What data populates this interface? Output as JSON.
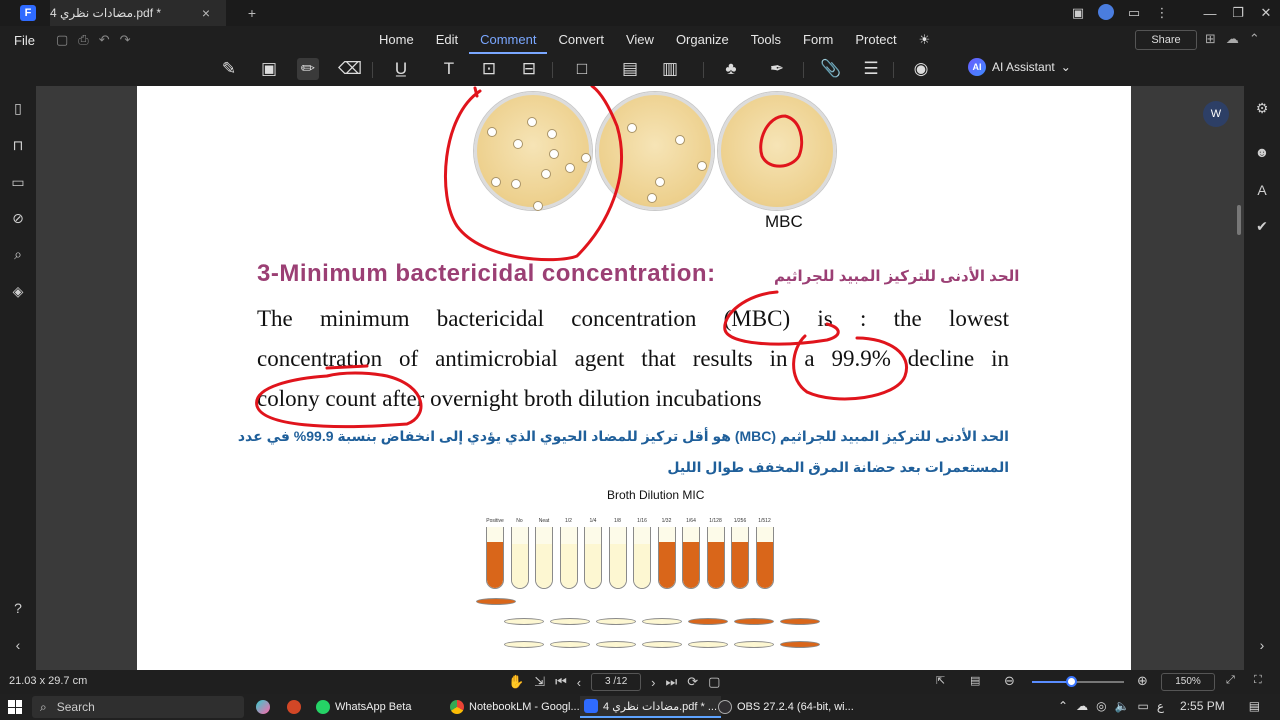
{
  "titlebar": {
    "tab_title": "4 مضادات نظري.pdf *",
    "close": "×",
    "new_tab": "+"
  },
  "menu": {
    "file": "File",
    "tabs": [
      "Home",
      "Edit",
      "Comment",
      "Convert",
      "View",
      "Organize",
      "Tools",
      "Form",
      "Protect"
    ],
    "active_tab": "Comment",
    "share": "Share",
    "ai_assistant": "AI Assistant"
  },
  "document": {
    "mbc_label": "MBC",
    "heading_en": "3-Minimum bactericidal concentration:",
    "heading_ar": "الحد الأدنى للتركيز المبيد للجراثيم",
    "body": {
      "line1": "The minimum bactericidal concentration (MBC) is : the lowest",
      "line2": "concentration of antimicrobial agent that results in a 99.9% decline in",
      "line3": "colony count after overnight broth dilution incubations"
    },
    "arabic_def_line1": "الحد الأدنى للتركيز المبيد للجراثيم (MBC) هو أقل تركيز للمضاد الحيوي الذي يؤدي إلى انخفاض بنسبة 99.9% في عدد",
    "arabic_def_line2": "المستعمرات بعد حضانة المرق المخفف طوال الليل",
    "figure_title": "Broth Dilution MIC",
    "tube_labels": [
      "Positive growth control",
      "No inoculum",
      "Neat",
      "1/2",
      "1/4",
      "1/8",
      "1/16",
      "1/32",
      "1/64",
      "1/128",
      "1/256",
      "1/512"
    ],
    "tube_turbid": [
      true,
      false,
      false,
      false,
      false,
      false,
      false,
      true,
      true,
      true,
      true,
      true
    ],
    "turbid_color": "#d9661a",
    "clear_color": "#fdf7d2",
    "annotation_color": "#e0141c"
  },
  "status": {
    "page_size": "21.03 x 29.7 cm",
    "page_indicator": "3 /12",
    "zoom": "150%",
    "zoom_fraction": 0.44
  },
  "taskbar": {
    "search": "Search",
    "apps": [
      "WhatsApp Beta",
      "NotebookLM - Googl...",
      "4 مضادات نظري.pdf * ...",
      "OBS 27.2.4 (64-bit, wi..."
    ],
    "lang": "ع",
    "time": "2:55 PM"
  }
}
